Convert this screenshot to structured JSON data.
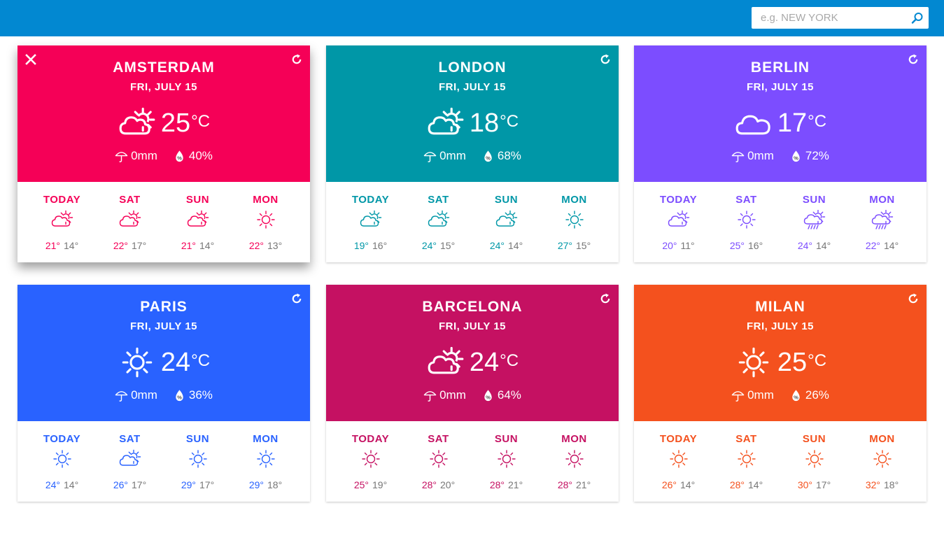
{
  "search": {
    "placeholder": "e.g. NEW YORK"
  },
  "cards": [
    {
      "city": "AMSTERDAM",
      "date": "FRI, JULY 15",
      "color": "#f50057",
      "icon": "partly-cloudy-icon",
      "temp": "25",
      "unit": "°C",
      "rain": "0mm",
      "humidity": "40%",
      "days": [
        {
          "name": "TODAY",
          "icon": "partly-cloudy-icon",
          "hi": "21°",
          "lo": "14°"
        },
        {
          "name": "SAT",
          "icon": "partly-cloudy-icon",
          "hi": "22°",
          "lo": "17°"
        },
        {
          "name": "SUN",
          "icon": "partly-cloudy-icon",
          "hi": "21°",
          "lo": "14°"
        },
        {
          "name": "MON",
          "icon": "sun-icon",
          "hi": "22°",
          "lo": "13°"
        }
      ]
    },
    {
      "city": "LONDON",
      "date": "FRI, JULY 15",
      "color": "#0097a7",
      "icon": "partly-cloudy-icon",
      "temp": "18",
      "unit": "°C",
      "rain": "0mm",
      "humidity": "68%",
      "days": [
        {
          "name": "TODAY",
          "icon": "partly-cloudy-icon",
          "hi": "19°",
          "lo": "16°"
        },
        {
          "name": "SAT",
          "icon": "partly-cloudy-icon",
          "hi": "24°",
          "lo": "15°"
        },
        {
          "name": "SUN",
          "icon": "partly-cloudy-icon",
          "hi": "24°",
          "lo": "14°"
        },
        {
          "name": "MON",
          "icon": "sun-icon",
          "hi": "27°",
          "lo": "15°"
        }
      ]
    },
    {
      "city": "BERLIN",
      "date": "FRI, JULY 15",
      "color": "#7c4dff",
      "icon": "cloud-icon",
      "temp": "17",
      "unit": "°C",
      "rain": "0mm",
      "humidity": "72%",
      "days": [
        {
          "name": "TODAY",
          "icon": "partly-cloudy-icon",
          "hi": "20°",
          "lo": "11°"
        },
        {
          "name": "SAT",
          "icon": "sun-icon",
          "hi": "25°",
          "lo": "16°"
        },
        {
          "name": "SUN",
          "icon": "rain-icon",
          "hi": "24°",
          "lo": "14°"
        },
        {
          "name": "MON",
          "icon": "rain-icon",
          "hi": "22°",
          "lo": "14°"
        }
      ]
    },
    {
      "city": "PARIS",
      "date": "FRI, JULY 15",
      "color": "#2962ff",
      "icon": "sun-icon",
      "temp": "24",
      "unit": "°C",
      "rain": "0mm",
      "humidity": "36%",
      "days": [
        {
          "name": "TODAY",
          "icon": "sun-icon",
          "hi": "24°",
          "lo": "14°"
        },
        {
          "name": "SAT",
          "icon": "partly-cloudy-icon",
          "hi": "26°",
          "lo": "17°"
        },
        {
          "name": "SUN",
          "icon": "sun-icon",
          "hi": "29°",
          "lo": "17°"
        },
        {
          "name": "MON",
          "icon": "sun-icon",
          "hi": "29°",
          "lo": "18°"
        }
      ]
    },
    {
      "city": "BARCELONA",
      "date": "FRI, JULY 15",
      "color": "#c51162",
      "icon": "partly-cloudy-icon",
      "temp": "24",
      "unit": "°C",
      "rain": "0mm",
      "humidity": "64%",
      "days": [
        {
          "name": "TODAY",
          "icon": "sun-icon",
          "hi": "25°",
          "lo": "19°"
        },
        {
          "name": "SAT",
          "icon": "sun-icon",
          "hi": "28°",
          "lo": "20°"
        },
        {
          "name": "SUN",
          "icon": "sun-icon",
          "hi": "28°",
          "lo": "21°"
        },
        {
          "name": "MON",
          "icon": "sun-icon",
          "hi": "28°",
          "lo": "21°"
        }
      ]
    },
    {
      "city": "MILAN",
      "date": "FRI, JULY 15",
      "color": "#f4511e",
      "icon": "sun-icon",
      "temp": "25",
      "unit": "°C",
      "rain": "0mm",
      "humidity": "26%",
      "days": [
        {
          "name": "TODAY",
          "icon": "sun-icon",
          "hi": "26°",
          "lo": "14°"
        },
        {
          "name": "SAT",
          "icon": "sun-icon",
          "hi": "28°",
          "lo": "14°"
        },
        {
          "name": "SUN",
          "icon": "sun-icon",
          "hi": "30°",
          "lo": "17°"
        },
        {
          "name": "MON",
          "icon": "sun-icon",
          "hi": "32°",
          "lo": "18°"
        }
      ]
    }
  ]
}
